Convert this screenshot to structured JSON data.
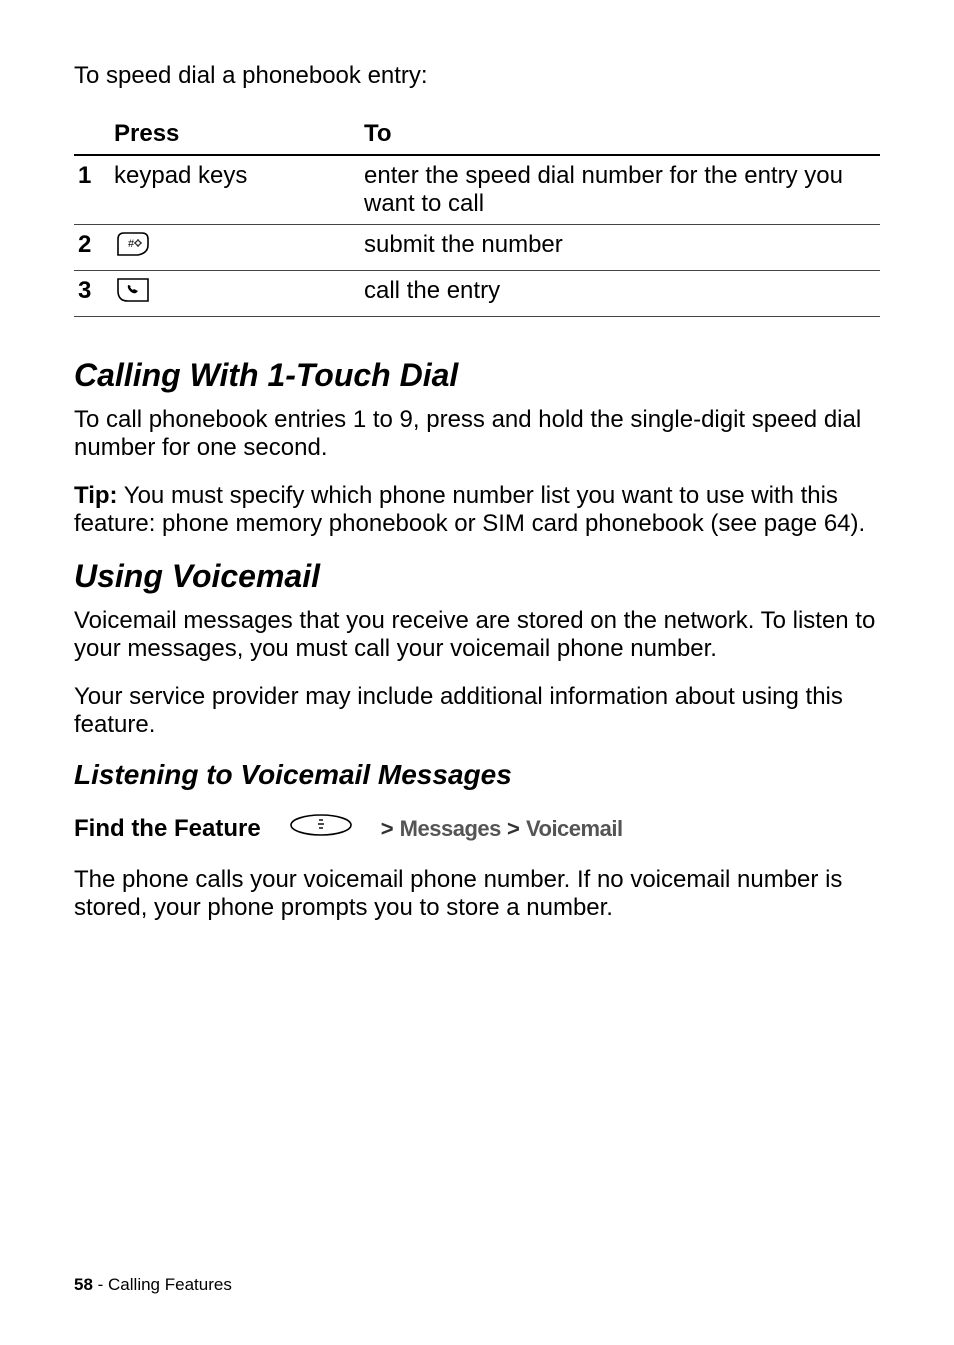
{
  "intro": "To speed dial a phonebook entry:",
  "table": {
    "head_press": "Press",
    "head_to": "To",
    "rows": [
      {
        "n": "1",
        "press": "keypad keys",
        "to": "enter the speed dial number for the entry you want to call",
        "icon": null
      },
      {
        "n": "2",
        "press": "",
        "to": "submit the number",
        "icon": "hash-key"
      },
      {
        "n": "3",
        "press": "",
        "to": "call the entry",
        "icon": "send-key"
      }
    ]
  },
  "section1": {
    "title": "Calling With 1-Touch Dial",
    "p1": "To call phonebook entries 1 to 9, press and hold the single-digit speed dial number for one second.",
    "tip_label": "Tip:",
    "tip_body": " You must specify which phone number list you want to use with this feature: phone memory phonebook or SIM card phonebook (see page 64)."
  },
  "section2": {
    "title": "Using Voicemail",
    "p1": "Voicemail messages that you receive are stored on the network. To listen to your messages, you must call your voicemail phone number.",
    "p2": "Your service provider may include additional information about using this feature."
  },
  "subsection": {
    "title": "Listening to Voicemail Messages",
    "find_label": "Find the Feature",
    "bracket1": ">",
    "menu1": "Messages",
    "bracket2": ">",
    "menu2": "Voicemail",
    "p1": "The phone calls your voicemail phone number. If no voicemail number is stored, your phone prompts you to store a number."
  },
  "footer": {
    "page_number": "58",
    "sep": " - ",
    "section": "Calling Features"
  }
}
